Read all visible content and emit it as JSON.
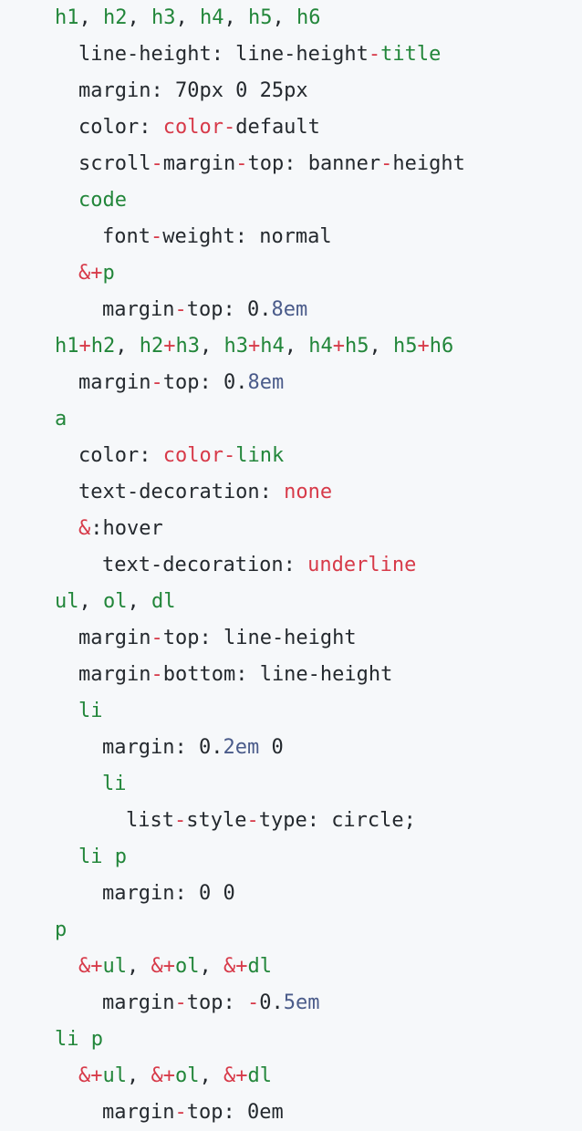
{
  "colors": {
    "background": "#f6f8fa",
    "default_text": "#24292e",
    "selector": "#22863a",
    "operator": "#d73a49",
    "number": "#4a5b8a"
  },
  "lines": [
    {
      "indent": 0,
      "tokens": [
        {
          "t": "h1",
          "c": "sel"
        },
        {
          "t": ", ",
          "c": "txt"
        },
        {
          "t": "h2",
          "c": "sel"
        },
        {
          "t": ", ",
          "c": "txt"
        },
        {
          "t": "h3",
          "c": "sel"
        },
        {
          "t": ", ",
          "c": "txt"
        },
        {
          "t": "h4",
          "c": "sel"
        },
        {
          "t": ", ",
          "c": "txt"
        },
        {
          "t": "h5",
          "c": "sel"
        },
        {
          "t": ", ",
          "c": "txt"
        },
        {
          "t": "h6",
          "c": "sel"
        }
      ]
    },
    {
      "indent": 1,
      "tokens": [
        {
          "t": "line-height: line-height",
          "c": "txt"
        },
        {
          "t": "-",
          "c": "op"
        },
        {
          "t": "title",
          "c": "sel"
        }
      ]
    },
    {
      "indent": 1,
      "tokens": [
        {
          "t": "margin: 70px 0 25px",
          "c": "txt"
        }
      ]
    },
    {
      "indent": 1,
      "tokens": [
        {
          "t": "color: ",
          "c": "txt"
        },
        {
          "t": "color",
          "c": "kw"
        },
        {
          "t": "-",
          "c": "op"
        },
        {
          "t": "default",
          "c": "txt"
        }
      ]
    },
    {
      "indent": 1,
      "tokens": [
        {
          "t": "scroll",
          "c": "txt"
        },
        {
          "t": "-",
          "c": "op"
        },
        {
          "t": "margin",
          "c": "txt"
        },
        {
          "t": "-",
          "c": "op"
        },
        {
          "t": "top: banner",
          "c": "txt"
        },
        {
          "t": "-",
          "c": "op"
        },
        {
          "t": "height",
          "c": "txt"
        }
      ]
    },
    {
      "indent": 1,
      "tokens": [
        {
          "t": "code",
          "c": "sel"
        }
      ]
    },
    {
      "indent": 2,
      "tokens": [
        {
          "t": "font",
          "c": "txt"
        },
        {
          "t": "-",
          "c": "op"
        },
        {
          "t": "weight: normal",
          "c": "txt"
        }
      ]
    },
    {
      "indent": 1,
      "tokens": [
        {
          "t": "&+",
          "c": "op"
        },
        {
          "t": "p",
          "c": "sel"
        }
      ]
    },
    {
      "indent": 2,
      "tokens": [
        {
          "t": "margin",
          "c": "txt"
        },
        {
          "t": "-",
          "c": "op"
        },
        {
          "t": "top: 0.",
          "c": "txt"
        },
        {
          "t": "8em",
          "c": "numdim"
        }
      ]
    },
    {
      "indent": 0,
      "tokens": [
        {
          "t": "h1",
          "c": "sel"
        },
        {
          "t": "+",
          "c": "op"
        },
        {
          "t": "h2",
          "c": "sel"
        },
        {
          "t": ", ",
          "c": "txt"
        },
        {
          "t": "h2",
          "c": "sel"
        },
        {
          "t": "+",
          "c": "op"
        },
        {
          "t": "h3",
          "c": "sel"
        },
        {
          "t": ", ",
          "c": "txt"
        },
        {
          "t": "h3",
          "c": "sel"
        },
        {
          "t": "+",
          "c": "op"
        },
        {
          "t": "h4",
          "c": "sel"
        },
        {
          "t": ", ",
          "c": "txt"
        },
        {
          "t": "h4",
          "c": "sel"
        },
        {
          "t": "+",
          "c": "op"
        },
        {
          "t": "h5",
          "c": "sel"
        },
        {
          "t": ", ",
          "c": "txt"
        },
        {
          "t": "h5",
          "c": "sel"
        },
        {
          "t": "+",
          "c": "op"
        },
        {
          "t": "h6",
          "c": "sel"
        }
      ]
    },
    {
      "indent": 1,
      "tokens": [
        {
          "t": "margin",
          "c": "txt"
        },
        {
          "t": "-",
          "c": "op"
        },
        {
          "t": "top: 0.",
          "c": "txt"
        },
        {
          "t": "8em",
          "c": "numdim"
        }
      ]
    },
    {
      "indent": 0,
      "tokens": [
        {
          "t": "a",
          "c": "sel"
        }
      ]
    },
    {
      "indent": 1,
      "tokens": [
        {
          "t": "color: ",
          "c": "txt"
        },
        {
          "t": "color",
          "c": "kw"
        },
        {
          "t": "-",
          "c": "op"
        },
        {
          "t": "link",
          "c": "sel"
        }
      ]
    },
    {
      "indent": 1,
      "tokens": [
        {
          "t": "text-decoration: ",
          "c": "txt"
        },
        {
          "t": "none",
          "c": "kw"
        }
      ]
    },
    {
      "indent": 1,
      "tokens": [
        {
          "t": "&",
          "c": "op"
        },
        {
          "t": ":hover",
          "c": "txt"
        }
      ]
    },
    {
      "indent": 2,
      "tokens": [
        {
          "t": "text-decoration: ",
          "c": "txt"
        },
        {
          "t": "underline",
          "c": "kw"
        }
      ]
    },
    {
      "indent": 0,
      "tokens": [
        {
          "t": "ul",
          "c": "sel"
        },
        {
          "t": ", ",
          "c": "txt"
        },
        {
          "t": "ol",
          "c": "sel"
        },
        {
          "t": ", ",
          "c": "txt"
        },
        {
          "t": "dl",
          "c": "sel"
        }
      ]
    },
    {
      "indent": 1,
      "tokens": [
        {
          "t": "margin",
          "c": "txt"
        },
        {
          "t": "-",
          "c": "op"
        },
        {
          "t": "top: line-height",
          "c": "txt"
        }
      ]
    },
    {
      "indent": 1,
      "tokens": [
        {
          "t": "margin",
          "c": "txt"
        },
        {
          "t": "-",
          "c": "op"
        },
        {
          "t": "bottom: line-height",
          "c": "txt"
        }
      ]
    },
    {
      "indent": 1,
      "tokens": [
        {
          "t": "li",
          "c": "sel"
        }
      ]
    },
    {
      "indent": 2,
      "tokens": [
        {
          "t": "margin: 0.",
          "c": "txt"
        },
        {
          "t": "2em",
          "c": "numdim"
        },
        {
          "t": " 0",
          "c": "txt"
        }
      ]
    },
    {
      "indent": 2,
      "tokens": [
        {
          "t": "li",
          "c": "sel"
        }
      ]
    },
    {
      "indent": 3,
      "tokens": [
        {
          "t": "list",
          "c": "txt"
        },
        {
          "t": "-",
          "c": "op"
        },
        {
          "t": "style",
          "c": "txt"
        },
        {
          "t": "-",
          "c": "op"
        },
        {
          "t": "type: circle;",
          "c": "txt"
        }
      ]
    },
    {
      "indent": 1,
      "tokens": [
        {
          "t": "li p",
          "c": "sel"
        }
      ]
    },
    {
      "indent": 2,
      "tokens": [
        {
          "t": "margin: 0 0",
          "c": "txt"
        }
      ]
    },
    {
      "indent": 0,
      "tokens": [
        {
          "t": "p",
          "c": "sel"
        }
      ]
    },
    {
      "indent": 1,
      "tokens": [
        {
          "t": "&+",
          "c": "op"
        },
        {
          "t": "ul",
          "c": "sel"
        },
        {
          "t": ", ",
          "c": "txt"
        },
        {
          "t": "&+",
          "c": "op"
        },
        {
          "t": "ol",
          "c": "sel"
        },
        {
          "t": ", ",
          "c": "txt"
        },
        {
          "t": "&+",
          "c": "op"
        },
        {
          "t": "dl",
          "c": "sel"
        }
      ]
    },
    {
      "indent": 2,
      "tokens": [
        {
          "t": "margin",
          "c": "txt"
        },
        {
          "t": "-",
          "c": "op"
        },
        {
          "t": "top: ",
          "c": "txt"
        },
        {
          "t": "-",
          "c": "op"
        },
        {
          "t": "0.",
          "c": "txt"
        },
        {
          "t": "5em",
          "c": "numdim"
        }
      ]
    },
    {
      "indent": 0,
      "tokens": [
        {
          "t": "li p",
          "c": "sel"
        }
      ]
    },
    {
      "indent": 1,
      "tokens": [
        {
          "t": "&+",
          "c": "op"
        },
        {
          "t": "ul",
          "c": "sel"
        },
        {
          "t": ", ",
          "c": "txt"
        },
        {
          "t": "&+",
          "c": "op"
        },
        {
          "t": "ol",
          "c": "sel"
        },
        {
          "t": ", ",
          "c": "txt"
        },
        {
          "t": "&+",
          "c": "op"
        },
        {
          "t": "dl",
          "c": "sel"
        }
      ]
    },
    {
      "indent": 2,
      "tokens": [
        {
          "t": "margin",
          "c": "txt"
        },
        {
          "t": "-",
          "c": "op"
        },
        {
          "t": "top: 0em",
          "c": "txt"
        }
      ]
    }
  ]
}
